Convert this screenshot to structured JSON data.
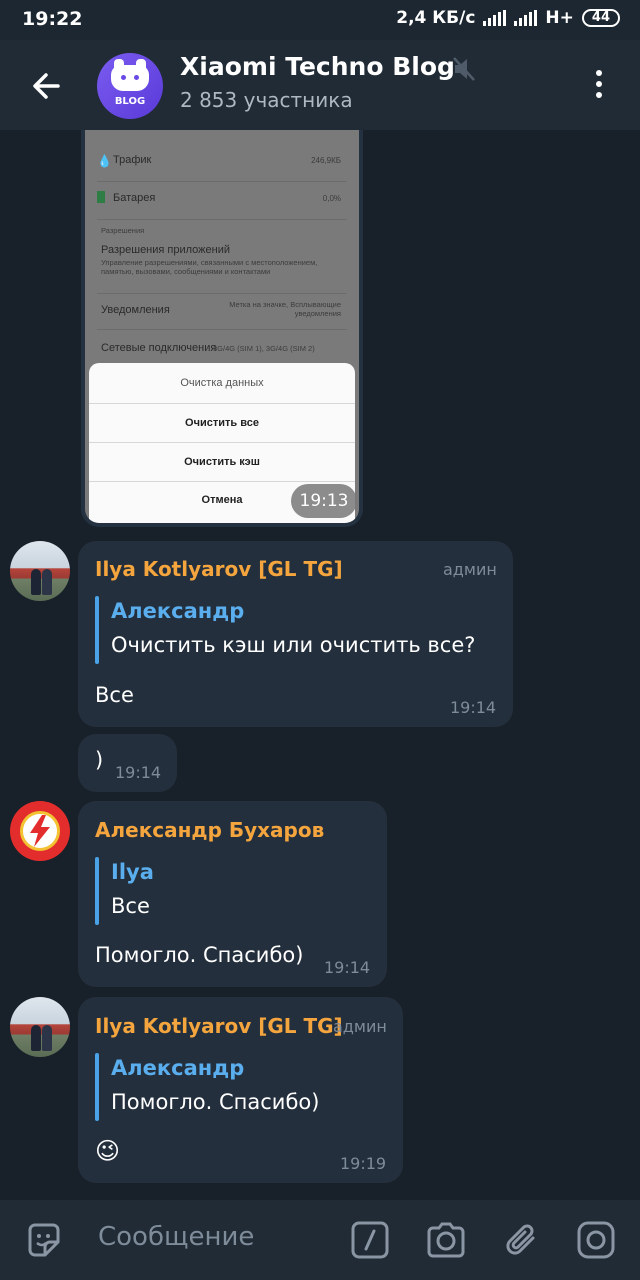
{
  "status": {
    "time": "19:22",
    "speed": "2,4 КБ/с",
    "net": "H+",
    "battery": "44"
  },
  "header": {
    "title": "Xiaomi Techno Blog",
    "subtitle": "2 853 участника",
    "avatar_text": "BLOG"
  },
  "media_message": {
    "time": "19:13",
    "screenshot": {
      "traffic_label": "Трафик",
      "traffic_value": "246,9КБ",
      "battery_label": "Батарея",
      "battery_value": "0,0%",
      "section_label": "Разрешения",
      "perm_title": "Разрешения приложений",
      "perm_desc": "Управление разрешениями, связанными с местоположением, памятью, вызовами, сообщениями и контактами",
      "notif_title": "Уведомления",
      "notif_value": "Метка на значке, Всплывающие уведомления",
      "net_title": "Сетевые подключения",
      "net_value": "3G/4G (SIM 1), 3G/4G (SIM 2)",
      "dialog_title": "Очистка данных",
      "dialog_clear_all": "Очистить все",
      "dialog_clear_cache": "Очистить кэш",
      "dialog_cancel": "Отмена"
    }
  },
  "messages": [
    {
      "sender": "Ilya Kotlyarov [GL TG]",
      "role": "админ",
      "reply_name": "Александр",
      "reply_text": "Очистить кэш или очистить все?",
      "text": "Все",
      "time": "19:14"
    },
    {
      "text": ")",
      "time": "19:14"
    },
    {
      "sender": "Александр Бухаров",
      "reply_name": "Ilya",
      "reply_text": "Все",
      "text": "Помогло. Спасибо)",
      "time": "19:14"
    },
    {
      "sender": "Ilya Kotlyarov [GL TG]",
      "role": "админ",
      "reply_name": "Александр",
      "reply_text": "Помогло. Спасибо)",
      "text": "😉",
      "time": "19:19"
    }
  ],
  "composer": {
    "placeholder": "Сообщение"
  },
  "icons": [
    "back-arrow-icon",
    "mute-icon",
    "more-vertical-icon",
    "sticker-icon",
    "bot-command-icon",
    "camera-icon",
    "attach-icon",
    "instagram-icon"
  ]
}
